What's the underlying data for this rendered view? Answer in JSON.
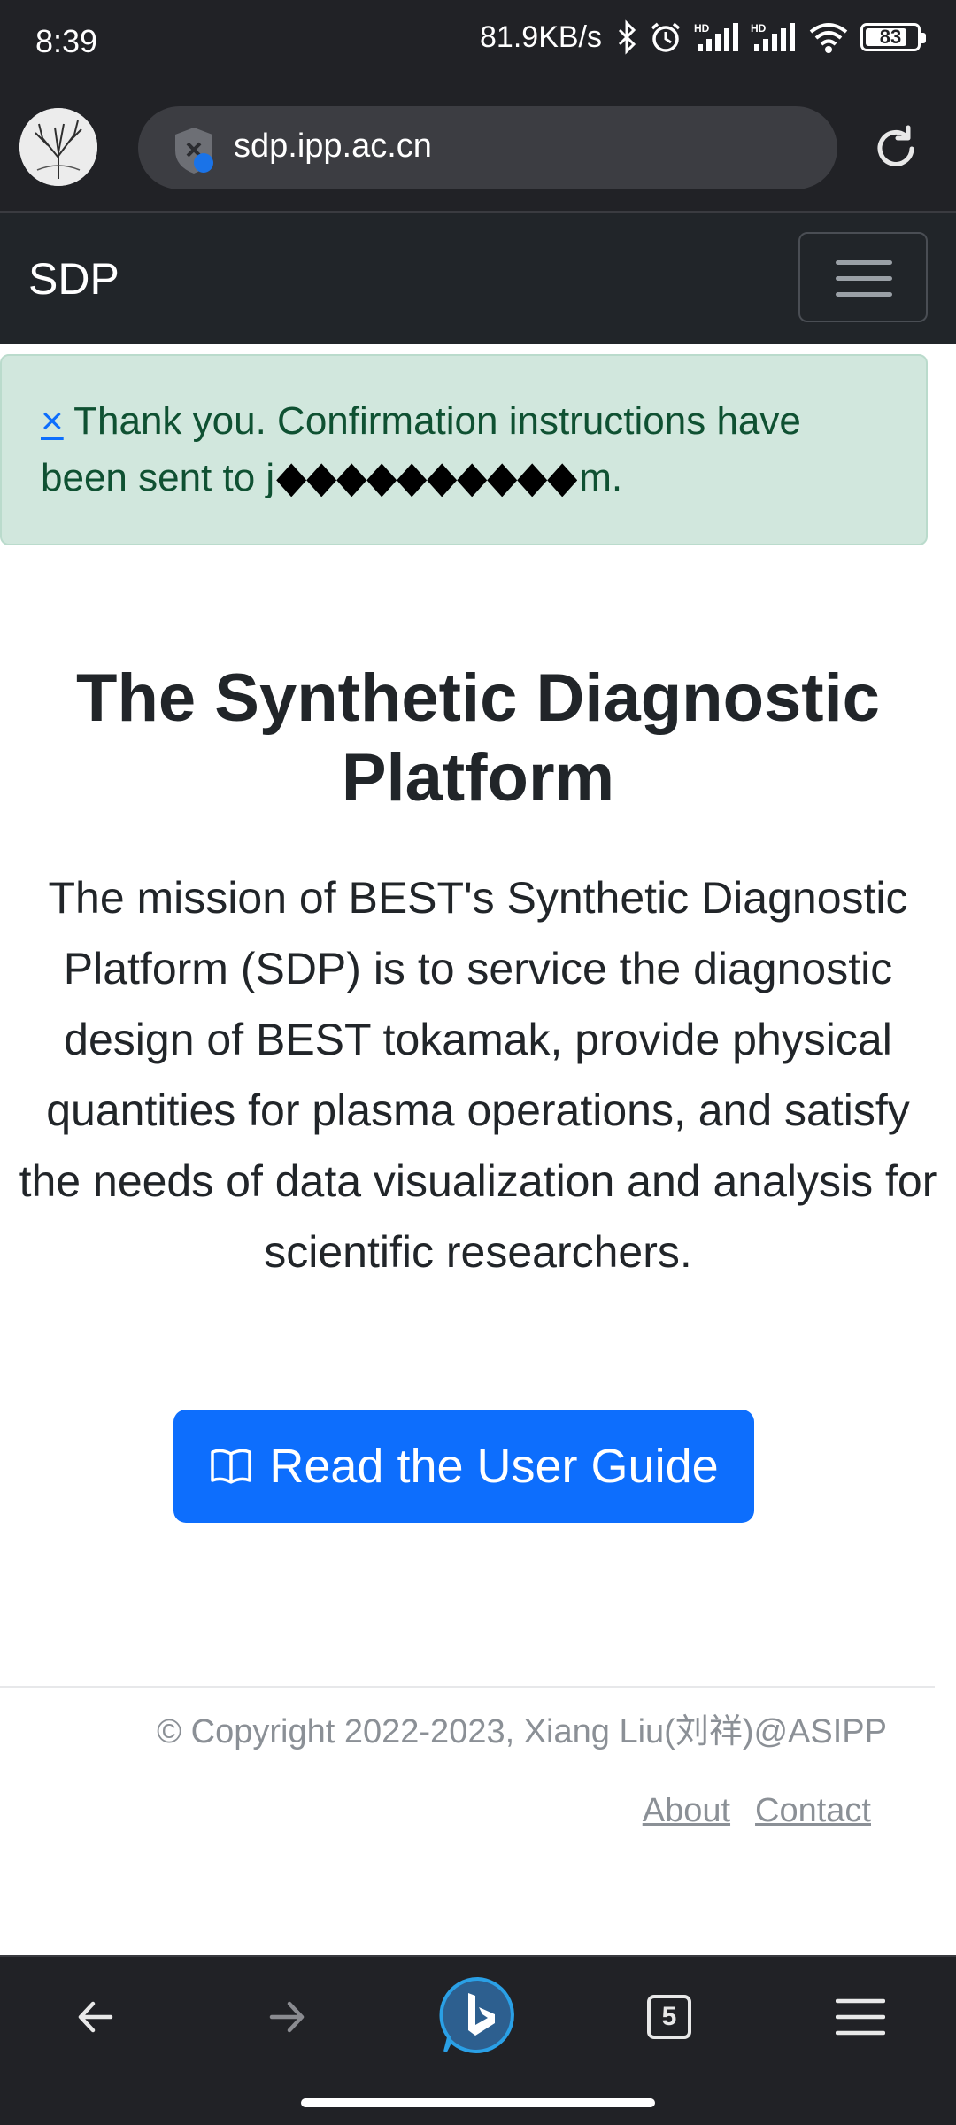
{
  "status_bar": {
    "time": "8:39",
    "speed": "81.9KB/s",
    "battery": "83",
    "battery_level": 0.83
  },
  "browser": {
    "url": "sdp.ipp.ac.cn",
    "tab_count": "5"
  },
  "navbar": {
    "brand": "SDP"
  },
  "alert": {
    "close": "×",
    "text_before": "Thank you. Confirmation instructions have been sent to j",
    "text_after": "m."
  },
  "hero": {
    "title": "The Synthetic Diagnostic Platform",
    "description": "The mission of BEST's Synthetic Diagnostic Platform (SDP) is to service the diagnostic design of BEST tokamak, provide physical quantities for plasma operations, and satisfy the needs of data visualization and analysis for scientific researchers.",
    "button_label": "Read the User Guide"
  },
  "footer": {
    "copyright": "© Copyright 2022-2023, Xiang Liu(刘祥)@ASIPP",
    "links": [
      "About",
      "Contact"
    ]
  },
  "colors": {
    "primary": "#0d6efd",
    "navbar": "#212529",
    "alert_bg": "#d1e7dd",
    "alert_text": "#0f5132"
  }
}
